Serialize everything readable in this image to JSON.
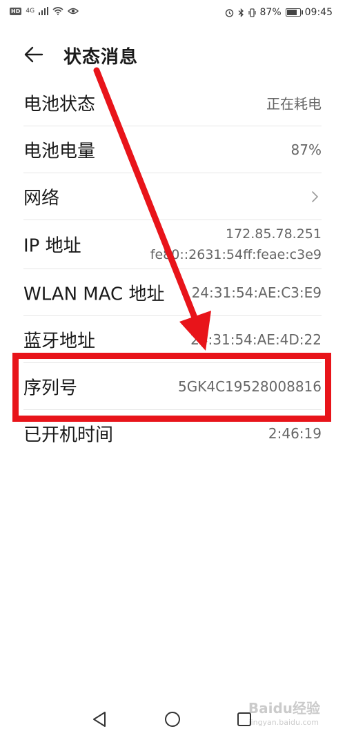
{
  "status_bar": {
    "hd_badge": "HD",
    "network_type": "4G",
    "battery_percent": "87%",
    "battery_level": 0.87,
    "time": "09:45"
  },
  "header": {
    "title": "状态消息"
  },
  "rows": [
    {
      "label": "电池状态",
      "value": "正在耗电"
    },
    {
      "label": "电池电量",
      "value": "87%"
    },
    {
      "label": "网络",
      "value": ""
    },
    {
      "label": "IP 地址",
      "value_line1": "172.85.78.251",
      "value_line2": "fe80::2631:54ff:feae:c3e9"
    },
    {
      "label": "WLAN MAC 地址",
      "value": "24:31:54:AE:C3:E9"
    },
    {
      "label": "蓝牙地址",
      "value": "24:31:54:AE:4D:22"
    },
    {
      "label": "序列号",
      "value": "5GK4C19528008816"
    },
    {
      "label": "已开机时间",
      "value": "2:46:19"
    }
  ],
  "watermark": {
    "text": "Baidu经验",
    "sub": "jingyan.baidu.com"
  },
  "colors": {
    "highlight": "#e8141a",
    "divider": "#e6e6e6",
    "value_text": "#666666"
  }
}
